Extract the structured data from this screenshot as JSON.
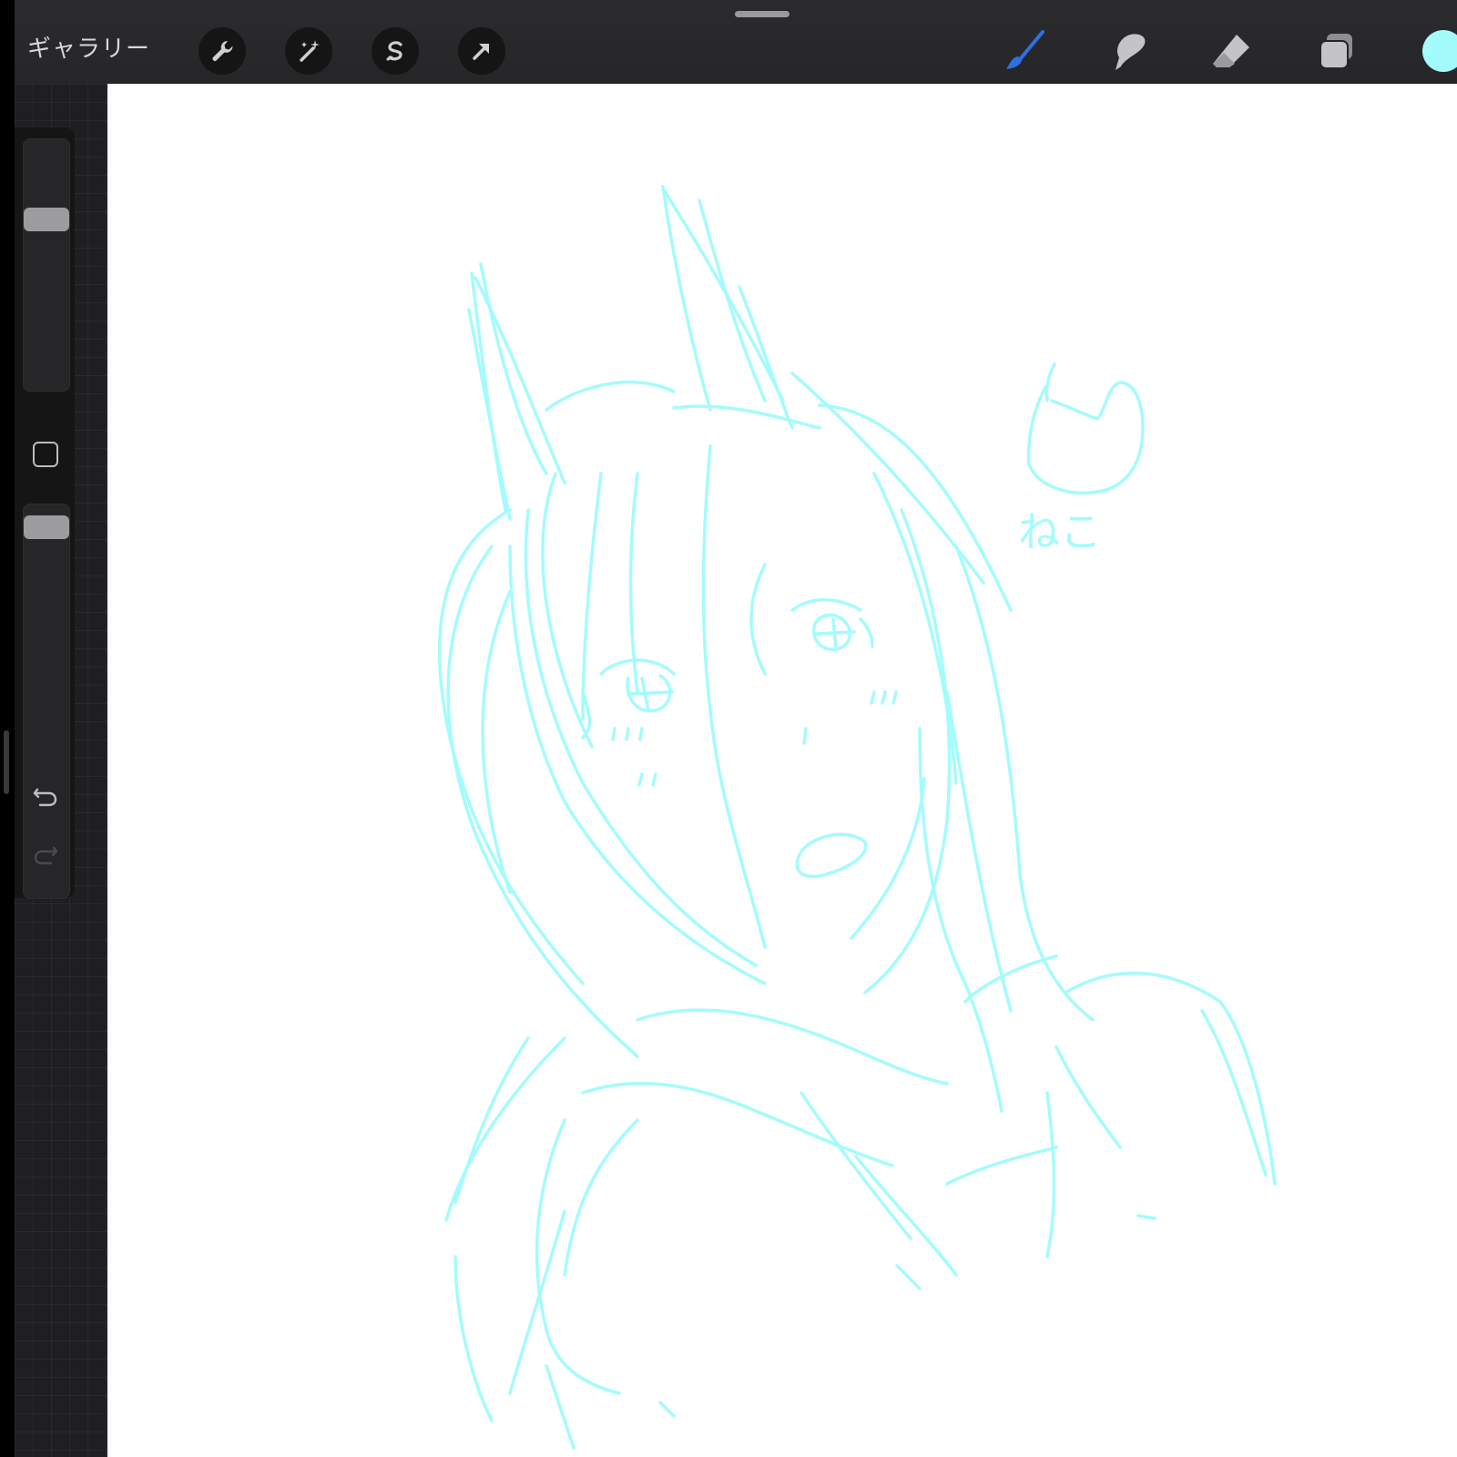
{
  "toolbar": {
    "gallery_label": "ギャラリー",
    "left_tools": [
      "wrench-icon",
      "magic-wand-icon",
      "selection-icon",
      "transform-arrow-icon"
    ],
    "right_tools": [
      "brush-icon",
      "smudge-icon",
      "eraser-icon",
      "layers-icon"
    ],
    "active_tool": "brush-icon",
    "brush_active_color": "#2f6fe6",
    "current_color": "#a4fbfc"
  },
  "sidebar": {
    "brush_size_level": 0.7,
    "opacity_level": 0.97,
    "undo_icon": "undo-arrow-icon",
    "redo_icon": "redo-arrow-icon"
  },
  "canvas": {
    "background": "#ffffff",
    "stroke_color": "#a4fbfc",
    "sketch_text": "ねこ"
  }
}
